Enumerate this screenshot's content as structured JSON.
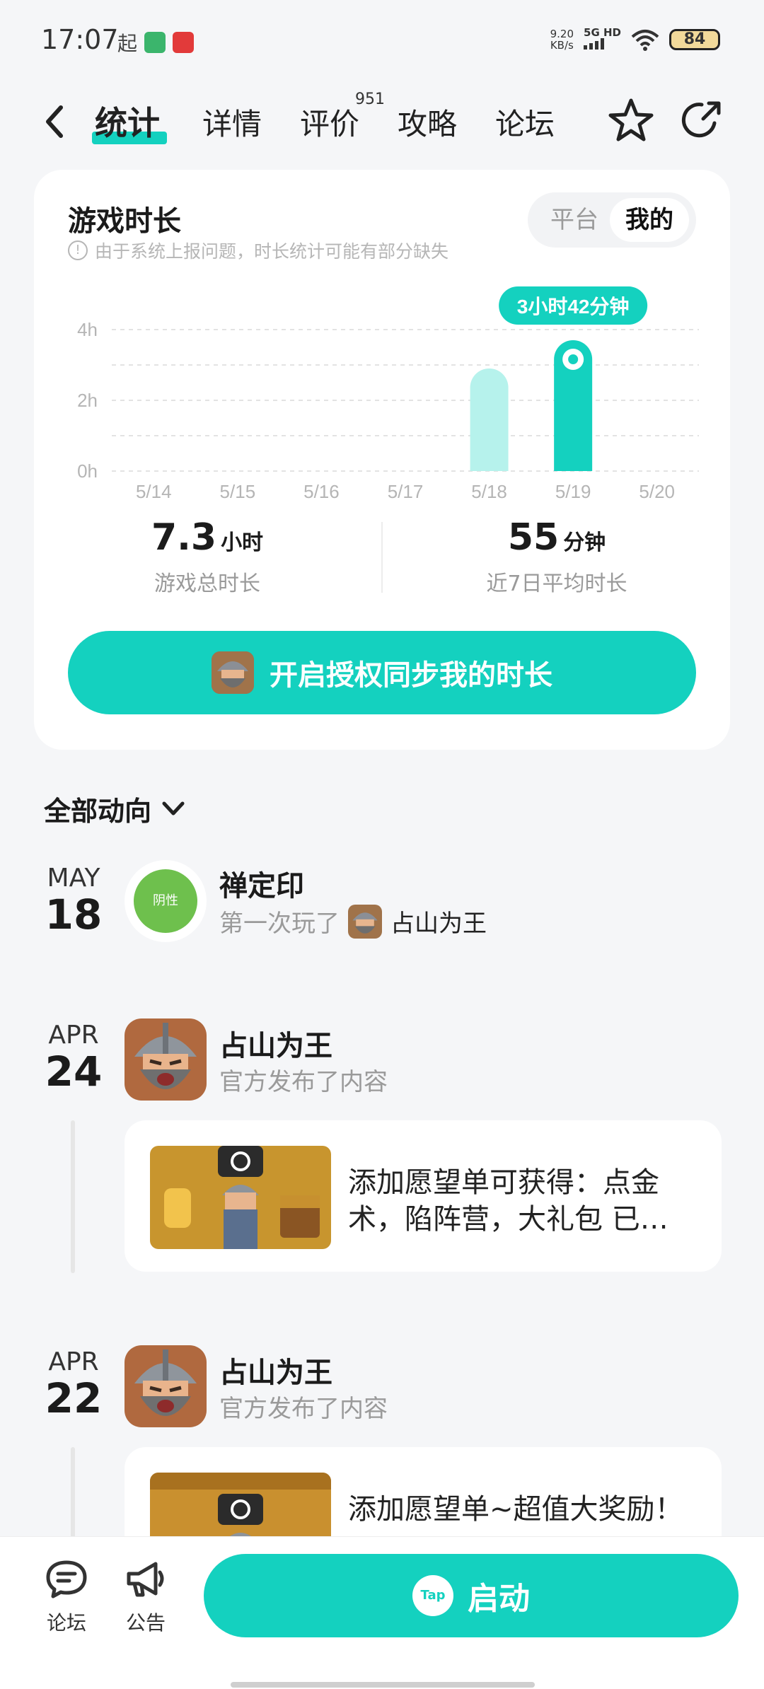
{
  "status_bar": {
    "time": "17:07",
    "q_icon": "起",
    "speed_value": "9.20",
    "speed_unit": "KB/s",
    "network": "5G HD",
    "battery": "84"
  },
  "nav": {
    "tabs": [
      {
        "label": "统计",
        "active": true
      },
      {
        "label": "详情"
      },
      {
        "label": "评价",
        "badge": "951"
      },
      {
        "label": "攻略"
      },
      {
        "label": "论坛"
      }
    ],
    "icons": [
      "back-icon",
      "star-icon",
      "share-icon"
    ]
  },
  "stats_card": {
    "title": "游戏时长",
    "note": "由于系统上报问题，时长统计可能有部分缺失",
    "segment": {
      "options": [
        "平台",
        "我的"
      ],
      "selected": "我的"
    },
    "total": {
      "value": "7.3",
      "unit": "小时",
      "label": "游戏总时长"
    },
    "avg": {
      "value": "55",
      "unit": "分钟",
      "label": "近7日平均时长"
    },
    "sync_button": "开启授权同步我的时长"
  },
  "chart_data": {
    "type": "bar",
    "categories": [
      "5/14",
      "5/15",
      "5/16",
      "5/17",
      "5/18",
      "5/19",
      "5/20"
    ],
    "values": [
      0,
      0,
      0,
      0,
      2.9,
      3.7,
      0
    ],
    "y_ticks": [
      "0h",
      "2h",
      "4h"
    ],
    "ylim": [
      0,
      4
    ],
    "highlight_index": 5,
    "highlight_label": "3小时42分钟",
    "colors": {
      "bar": "#b6f2ec",
      "highlight": "#14d1bf"
    }
  },
  "feed": {
    "header": "全部动向",
    "items": [
      {
        "month": "MAY",
        "day": "18",
        "avatar_label": "阴性",
        "name": "禅定印",
        "action": "第一次玩了",
        "game": "占山为王"
      },
      {
        "month": "APR",
        "day": "24",
        "name": "占山为王",
        "action": "官方发布了内容",
        "post_text": "添加愿望单可获得：点金术，陷阵营，大礼包 已…"
      },
      {
        "month": "APR",
        "day": "22",
        "name": "占山为王",
        "action": "官方发布了内容",
        "post_text": "添加愿望单~超值大奖励！"
      }
    ]
  },
  "bottom_bar": {
    "forum_label": "论坛",
    "notice_label": "公告",
    "launch_label": "启动",
    "launch_logo": "Tap"
  }
}
